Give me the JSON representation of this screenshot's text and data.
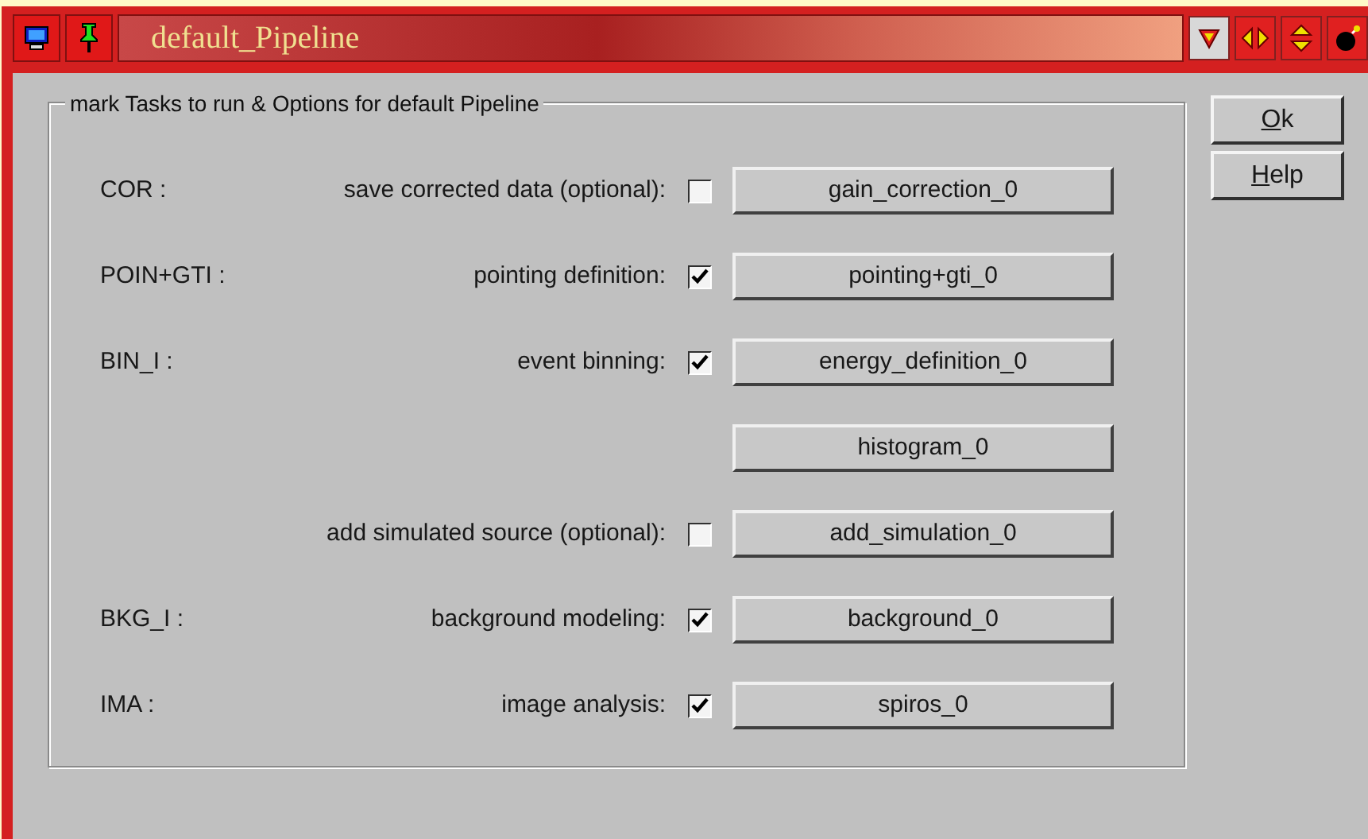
{
  "window": {
    "title": "default_Pipeline"
  },
  "group": {
    "title": "mark Tasks to run & Options for default Pipeline"
  },
  "rows": [
    {
      "tag": "COR :",
      "description": "save corrected data (optional):",
      "checked": false,
      "button": "gain_correction_0"
    },
    {
      "tag": "POIN+GTI :",
      "description": "pointing definition:",
      "checked": true,
      "button": "pointing+gti_0"
    },
    {
      "tag": "BIN_I :",
      "description": "event binning:",
      "checked": true,
      "button": "energy_definition_0"
    },
    {
      "button": "histogram_0"
    },
    {
      "description": "add simulated source (optional):",
      "checked": false,
      "button": "add_simulation_0"
    },
    {
      "tag": "BKG_I :",
      "description": "background modeling:",
      "checked": true,
      "button": "background_0"
    },
    {
      "tag": "IMA :",
      "description": "image analysis:",
      "checked": true,
      "button": "spiros_0"
    }
  ],
  "buttons": [
    {
      "label": "Ok",
      "mnemonic": true
    },
    {
      "label": "Help",
      "mnemonic": true
    }
  ]
}
